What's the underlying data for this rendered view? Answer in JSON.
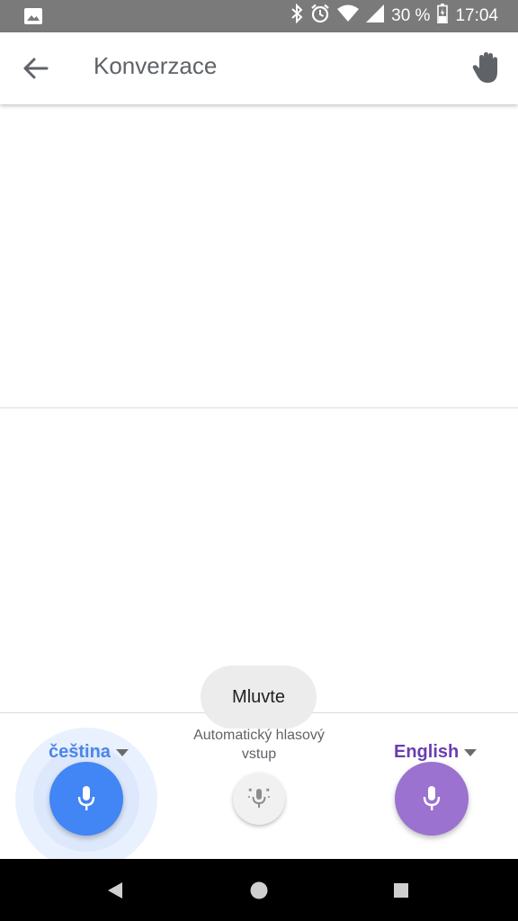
{
  "status_bar": {
    "battery_percent": "30 %",
    "time": "17:04",
    "icons": [
      "image-notification-icon",
      "bluetooth-icon",
      "alarm-icon",
      "wifi-icon",
      "signal-icon",
      "battery-icon"
    ]
  },
  "app_bar": {
    "title": "Konverzace",
    "back_icon": "arrow-back-icon",
    "action_icon": "hand-icon"
  },
  "tooltip": {
    "text": "Mluvte"
  },
  "controls": {
    "left_language": "čeština",
    "right_language": "English",
    "auto_voice_line1": "Automatický hlasový",
    "auto_voice_line2": "vstup"
  },
  "colors": {
    "left_accent": "#4285f4",
    "left_label": "#4a86e8",
    "right_accent": "#9b72cf",
    "right_label": "#6a3db0",
    "status_bar": "#7a7a7a"
  }
}
